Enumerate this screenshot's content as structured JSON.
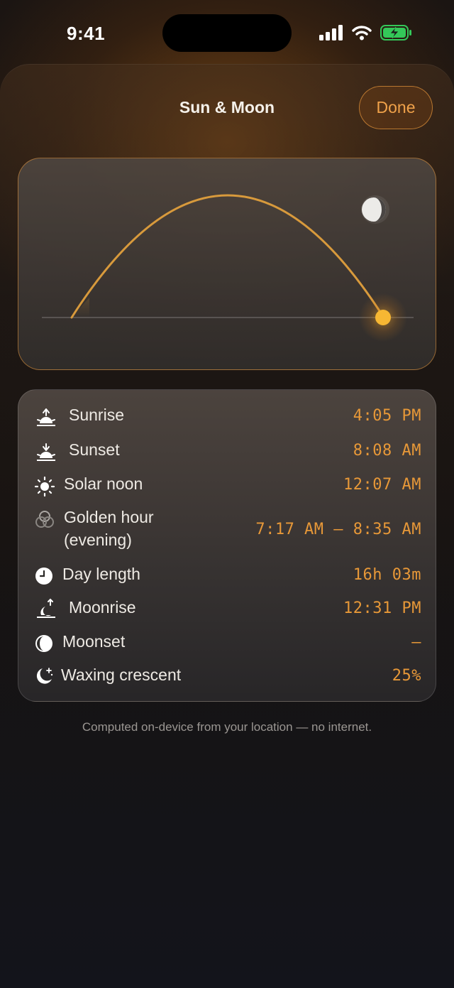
{
  "status_bar": {
    "time": "9:41"
  },
  "sheet": {
    "title": "Sun & Moon",
    "done_label": "Done"
  },
  "rows": [
    {
      "label": "Sunrise",
      "value": "4:05 PM",
      "icon": "sunrise-icon"
    },
    {
      "label": "Sunset",
      "value": "8:08 AM",
      "icon": "sunset-icon"
    },
    {
      "label": "Solar noon",
      "value": "12:07 AM",
      "icon": "sun-icon"
    },
    {
      "label": "Golden hour",
      "label2": "(evening)",
      "value": "7:17 AM – 8:35 AM",
      "icon": "golden-hour-icon"
    },
    {
      "label": "Day length",
      "value": "16h 03m",
      "icon": "clock-icon"
    },
    {
      "label": "Moonrise",
      "value": "12:31 PM",
      "icon": "moonrise-icon"
    },
    {
      "label": "Moonset",
      "value": "–",
      "icon": "moonset-icon"
    },
    {
      "label": "Waxing crescent",
      "value": "25%",
      "icon": "moon-phase-icon"
    }
  ],
  "footer": {
    "note": "Computed on-device from your location — no internet."
  },
  "colors": {
    "accent": "#e79838",
    "sun": "#f7b733",
    "arc": "#d89a3c"
  },
  "sun_progress": 0.95
}
